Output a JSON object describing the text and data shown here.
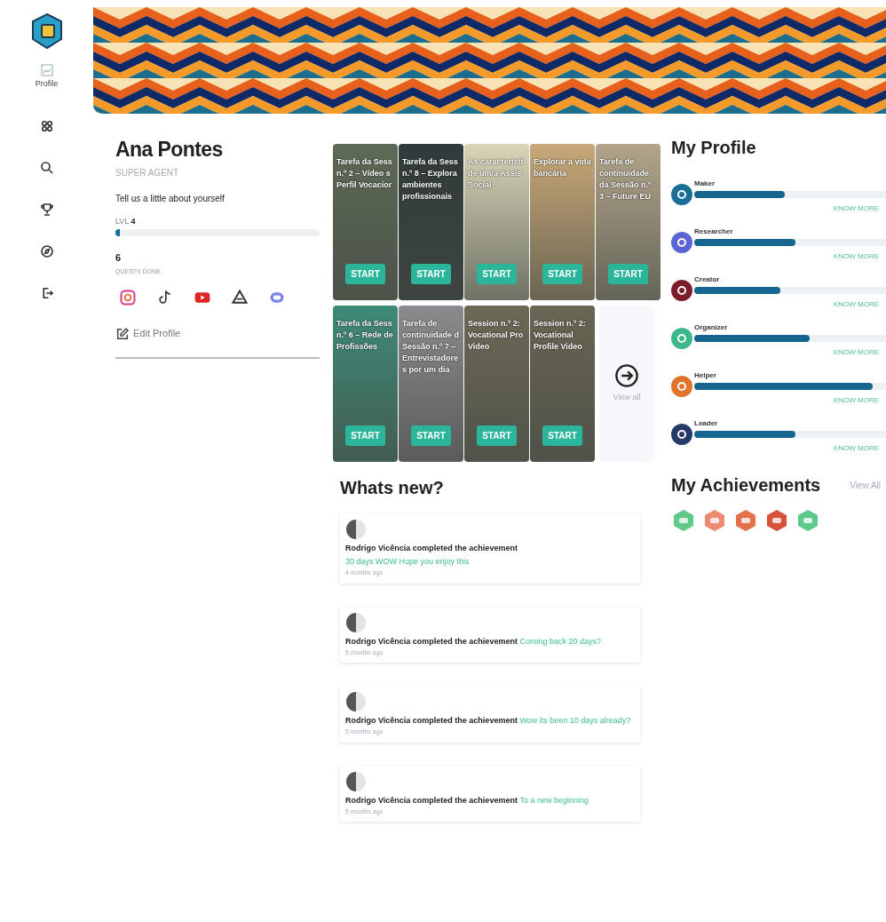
{
  "nav": {
    "profile_label": "Profile",
    "items": [
      {
        "kind": "apps",
        "selected": false
      },
      {
        "kind": "search",
        "selected": false
      },
      {
        "kind": "trophy",
        "selected": false
      },
      {
        "kind": "compass",
        "selected": false
      },
      {
        "kind": "logout",
        "selected": false
      }
    ]
  },
  "user": {
    "name": "Ana Pontes",
    "rank": "SUPER AGENT",
    "bio": "Tell us a little about yourself",
    "level_label": "LVL",
    "level_value": "4",
    "level": 0.02,
    "quests_count": "6",
    "quests_label": "QUESTS DONE",
    "socials": [
      {
        "kind": "instagram"
      },
      {
        "kind": "tiktok"
      },
      {
        "kind": "youtube"
      },
      {
        "kind": "linktree"
      },
      {
        "kind": "discord"
      }
    ],
    "edit_label": "Edit Profile"
  },
  "quests": {
    "rows": [
      [
        {
          "title": "Tarefa da Sess n.º 2 – Vídeo s Perfil Vocacior",
          "button": "START"
        },
        {
          "title": "Tarefa da Sess n.º 8 – Explora ambientes profissionais",
          "button": "START"
        },
        {
          "title": "As característi de um/a Assis Social",
          "button": "START"
        },
        {
          "title": "Explorar a vida bancária",
          "button": "START"
        },
        {
          "title": "Tarefa de continuidade da Sessão n.º 3 – Future EU",
          "button": "START"
        }
      ],
      [
        {
          "title": "Tarefa da Sess n.º 6 – Rede de Profissões",
          "button": "START"
        },
        {
          "title": "Tarefa de continuidade d Sessão n.º 7 – Entrevistadores por um dia",
          "button": "START"
        },
        {
          "title": "Session n.º 2: Vocational Pro Video",
          "button": "START"
        },
        {
          "title": "Session n.º 2: Vocational Profile Video",
          "button": "START"
        }
      ]
    ],
    "view_all": "View all"
  },
  "feed": {
    "title": "Whats new?",
    "items": [
      {
        "actor": "Rodrigo Vicência completed the achievement",
        "achievement": "30 days WOW Hope you enjoy this",
        "time": "4 months ago"
      },
      {
        "actor": "Rodrigo Vicência completed the achievement",
        "achievement": "Coming back 20 days?",
        "time": "5 months ago"
      },
      {
        "actor": "Rodrigo Vicência completed the achievement",
        "achievement": "Wow its been 10 days already?",
        "time": "5 months ago"
      },
      {
        "actor": "Rodrigo Vicência completed the achievement",
        "achievement": "To a new beginning",
        "time": "5 months ago"
      }
    ]
  },
  "profile": {
    "title": "My Profile",
    "traits": [
      {
        "name": "Maker",
        "color": "#1b6f97",
        "level": 0.47,
        "link": "KNOW MORE"
      },
      {
        "name": "Researcher",
        "color": "#5a66d6",
        "level": 0.53,
        "link": "KNOW MORE"
      },
      {
        "name": "Creator",
        "color": "#7a1f2a",
        "level": 0.45,
        "link": "KNOW MORE"
      },
      {
        "name": "Organizer",
        "color": "#3cb88a",
        "level": 0.6,
        "link": "KNOW MORE"
      },
      {
        "name": "Helper",
        "color": "#e0742a",
        "level": 0.93,
        "link": "KNOW MORE"
      },
      {
        "name": "Leader",
        "color": "#243a6a",
        "level": 0.53,
        "link": "KNOW MORE"
      }
    ]
  },
  "achievements": {
    "title": "My Achievements",
    "view_all": "View All",
    "badges": [
      {
        "color": "#5fc98a"
      },
      {
        "color": "#ee8a72"
      },
      {
        "color": "#e4704e"
      },
      {
        "color": "#d8523a"
      },
      {
        "color": "#5fc98a"
      }
    ]
  }
}
